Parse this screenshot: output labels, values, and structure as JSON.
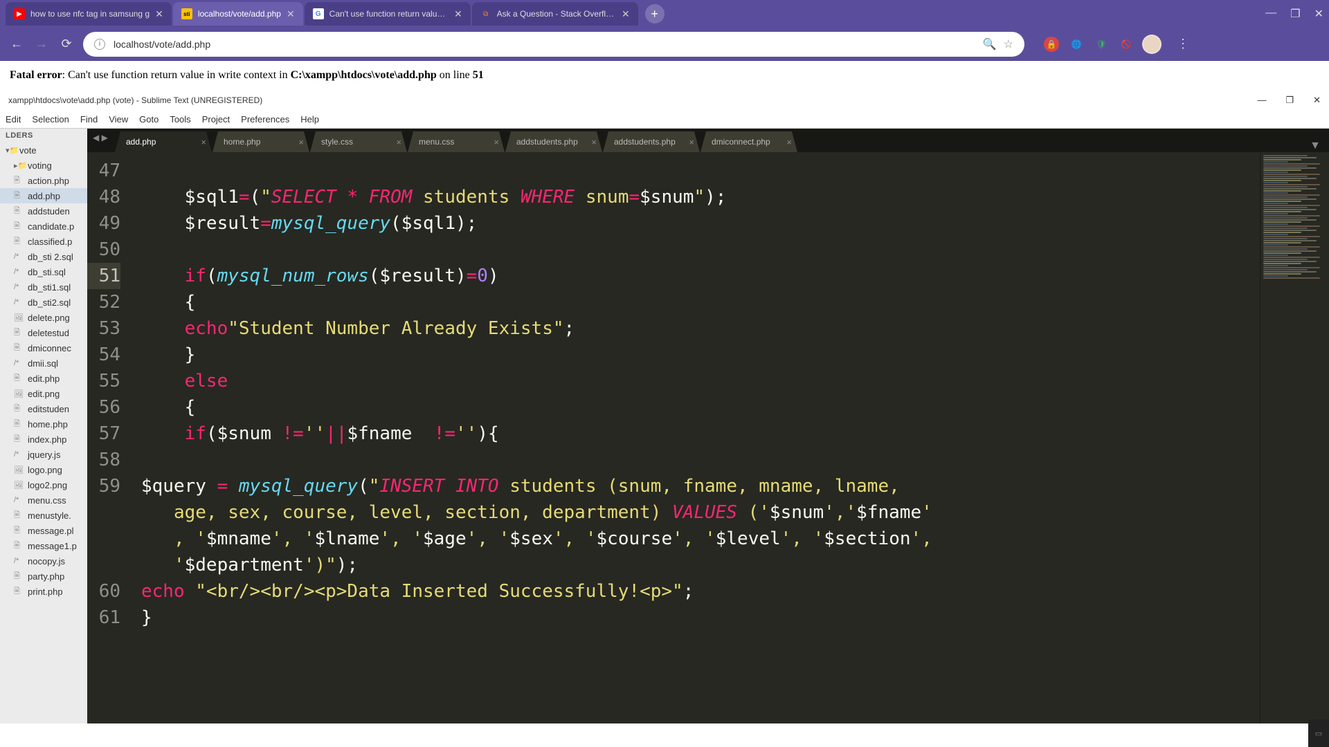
{
  "browser": {
    "tabs": [
      {
        "label": "how to use nfc tag in samsung g",
        "favicon": "yt"
      },
      {
        "label": "localhost/vote/add.php",
        "favicon": "sti",
        "active": true
      },
      {
        "label": "Can't use function return value in",
        "favicon": "google"
      },
      {
        "label": "Ask a Question - Stack Overflow",
        "favicon": "so"
      }
    ],
    "url": "localhost/vote/add.php",
    "window_controls": {
      "min": "—",
      "max": "❐",
      "close": "✕"
    }
  },
  "page_error": {
    "prefix": "Fatal error",
    "message": ": Can't use function return value in write context in ",
    "file": "C:\\xampp\\htdocs\\vote\\add.php",
    "line_label": " on line ",
    "line": "51"
  },
  "sublime": {
    "title": "xampp\\htdocs\\vote\\add.php (vote) - Sublime Text (UNREGISTERED)",
    "menu": [
      "Edit",
      "Selection",
      "Find",
      "View",
      "Goto",
      "Tools",
      "Project",
      "Preferences",
      "Help"
    ],
    "window_controls": {
      "min": "—",
      "max": "❐",
      "close": "✕"
    },
    "sidebar": {
      "header": "LDERS",
      "root": "vote",
      "folders": [
        "voting"
      ],
      "files": [
        "action.php",
        "add.php",
        "addstuden",
        "candidate.p",
        "classified.p",
        "db_sti 2.sql",
        "db_sti.sql",
        "db_sti1.sql",
        "db_sti2.sql",
        "delete.png",
        "deletestud",
        "dmiconnec",
        "dmii.sql",
        "edit.php",
        "edit.png",
        "editstuden",
        "home.php",
        "index.php",
        "jquery.js",
        "logo.png",
        "logo2.png",
        "menu.css",
        "menustyle.",
        "message.pl",
        "message1.p",
        "nocopy.js",
        "party.php",
        "print.php"
      ],
      "active_file": "add.php"
    },
    "tabs": [
      "add.php",
      "home.php",
      "style.css",
      "menu.css",
      "addstudents.php",
      "addstudents.php",
      "dmiconnect.php"
    ],
    "active_tab": "add.php",
    "line_numbers": [
      "47",
      "48",
      "49",
      "50",
      "51",
      "52",
      "53",
      "54",
      "55",
      "56",
      "57",
      "58",
      "59",
      "",
      "",
      "",
      "60",
      "61"
    ],
    "highlighted_line": "51",
    "code_lines": {
      "47": "",
      "48": {
        "indent": "    ",
        "parts": [
          {
            "t": "$sql1",
            "c": "txt"
          },
          {
            "t": "=",
            "c": "op"
          },
          {
            "t": "(",
            "c": "punct"
          },
          {
            "t": "\"",
            "c": "strlit"
          },
          {
            "t": "SELECT",
            "c": "sqlkw"
          },
          {
            "t": " ",
            "c": "strlit"
          },
          {
            "t": "*",
            "c": "op"
          },
          {
            "t": " ",
            "c": "strlit"
          },
          {
            "t": "FROM",
            "c": "sqlkw"
          },
          {
            "t": " students ",
            "c": "strlit"
          },
          {
            "t": "WHERE",
            "c": "sqlkw"
          },
          {
            "t": " snum",
            "c": "strlit"
          },
          {
            "t": "=",
            "c": "op"
          },
          {
            "t": "$snum",
            "c": "txt"
          },
          {
            "t": "\"",
            "c": "strlit"
          },
          {
            "t": ");",
            "c": "punct"
          }
        ]
      },
      "49": {
        "indent": "    ",
        "parts": [
          {
            "t": "$result",
            "c": "txt"
          },
          {
            "t": "=",
            "c": "op"
          },
          {
            "t": "mysql_query",
            "c": "fn"
          },
          {
            "t": "($sql1);",
            "c": "punct"
          }
        ]
      },
      "50": "",
      "51": {
        "indent": "    ",
        "parts": [
          {
            "t": "if",
            "c": "kw"
          },
          {
            "t": "(",
            "c": "punct"
          },
          {
            "t": "mysql_num_rows",
            "c": "fn"
          },
          {
            "t": "($result)",
            "c": "punct"
          },
          {
            "t": "=",
            "c": "op"
          },
          {
            "t": "0",
            "c": "num"
          },
          {
            "t": ")",
            "c": "punct"
          }
        ]
      },
      "52": {
        "indent": "    ",
        "parts": [
          {
            "t": "{",
            "c": "punct"
          }
        ]
      },
      "53": {
        "indent": "    ",
        "parts": [
          {
            "t": "echo",
            "c": "kw"
          },
          {
            "t": "\"Student Number Already Exists\"",
            "c": "strlit"
          },
          {
            "t": ";",
            "c": "punct"
          }
        ]
      },
      "54": {
        "indent": "    ",
        "parts": [
          {
            "t": "}",
            "c": "punct"
          }
        ]
      },
      "55": {
        "indent": "    ",
        "parts": [
          {
            "t": "else",
            "c": "kw"
          }
        ]
      },
      "56": {
        "indent": "    ",
        "parts": [
          {
            "t": "{",
            "c": "punct"
          }
        ]
      },
      "57": {
        "indent": "    ",
        "parts": [
          {
            "t": "if",
            "c": "kw"
          },
          {
            "t": "($snum ",
            "c": "punct"
          },
          {
            "t": "!=",
            "c": "op"
          },
          {
            "t": "''",
            "c": "strlit"
          },
          {
            "t": "||",
            "c": "op"
          },
          {
            "t": "$fname  ",
            "c": "punct"
          },
          {
            "t": "!=",
            "c": "op"
          },
          {
            "t": "''",
            "c": "strlit"
          },
          {
            "t": "){",
            "c": "punct"
          }
        ]
      },
      "58": "",
      "59": {
        "indent": "",
        "parts": [
          {
            "t": "$query ",
            "c": "txt"
          },
          {
            "t": "=",
            "c": "op"
          },
          {
            "t": " ",
            "c": "txt"
          },
          {
            "t": "mysql_query",
            "c": "fn"
          },
          {
            "t": "(",
            "c": "punct"
          },
          {
            "t": "\"",
            "c": "strlit"
          },
          {
            "t": "INSERT",
            "c": "sqlkw"
          },
          {
            "t": " ",
            "c": "strlit"
          },
          {
            "t": "INTO",
            "c": "sqlkw"
          },
          {
            "t": " students (snum, fname, mname, lname, ",
            "c": "strlit"
          }
        ]
      },
      "59b": {
        "indent": "   ",
        "parts": [
          {
            "t": "age, sex, course, level, section, department) ",
            "c": "strlit"
          },
          {
            "t": "VALUES",
            "c": "sqlkw"
          },
          {
            "t": " ('",
            "c": "strlit"
          },
          {
            "t": "$snum",
            "c": "txt"
          },
          {
            "t": "','",
            "c": "strlit"
          },
          {
            "t": "$fname",
            "c": "txt"
          },
          {
            "t": "'",
            "c": "strlit"
          }
        ]
      },
      "59c": {
        "indent": "   ",
        "parts": [
          {
            "t": ", '",
            "c": "strlit"
          },
          {
            "t": "$mname",
            "c": "txt"
          },
          {
            "t": "', '",
            "c": "strlit"
          },
          {
            "t": "$lname",
            "c": "txt"
          },
          {
            "t": "', '",
            "c": "strlit"
          },
          {
            "t": "$age",
            "c": "txt"
          },
          {
            "t": "', '",
            "c": "strlit"
          },
          {
            "t": "$sex",
            "c": "txt"
          },
          {
            "t": "', '",
            "c": "strlit"
          },
          {
            "t": "$course",
            "c": "txt"
          },
          {
            "t": "', '",
            "c": "strlit"
          },
          {
            "t": "$level",
            "c": "txt"
          },
          {
            "t": "', '",
            "c": "strlit"
          },
          {
            "t": "$section",
            "c": "txt"
          },
          {
            "t": "',",
            "c": "strlit"
          }
        ]
      },
      "59d": {
        "indent": "   ",
        "parts": [
          {
            "t": "'",
            "c": "strlit"
          },
          {
            "t": "$department",
            "c": "txt"
          },
          {
            "t": "')\"",
            "c": "strlit"
          },
          {
            "t": ");",
            "c": "punct"
          }
        ]
      },
      "60": {
        "indent": "",
        "parts": [
          {
            "t": "echo",
            "c": "kw"
          },
          {
            "t": " ",
            "c": "txt"
          },
          {
            "t": "\"<br/><br/><p>Data Inserted Successfully!<p>\"",
            "c": "strlit"
          },
          {
            "t": ";",
            "c": "punct"
          }
        ]
      },
      "61": {
        "indent": "",
        "parts": [
          {
            "t": "}",
            "c": "punct"
          }
        ]
      }
    }
  }
}
